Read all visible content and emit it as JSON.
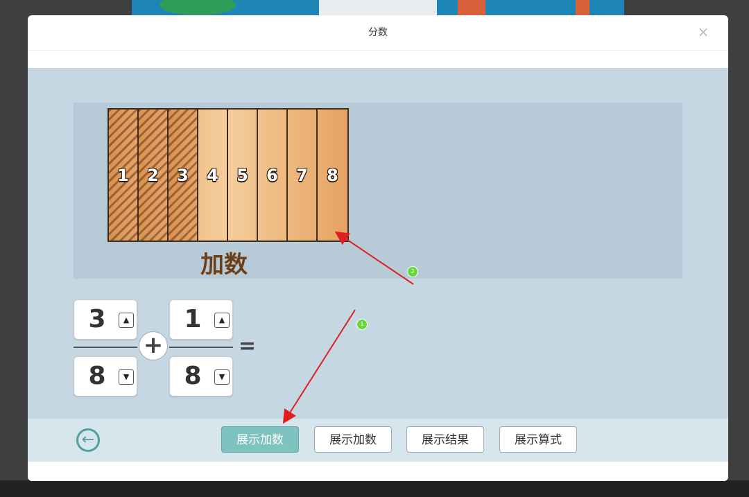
{
  "dialog": {
    "title": "分数",
    "close_label": "×"
  },
  "board": {
    "segments": [
      "1",
      "2",
      "3",
      "4",
      "5",
      "6",
      "7",
      "8"
    ],
    "hatched_count": 3,
    "label": "加数"
  },
  "fraction1": {
    "numerator": "3",
    "denominator": "8"
  },
  "fraction2": {
    "numerator": "1",
    "denominator": "8"
  },
  "operator": "+",
  "equals": "=",
  "steppers": {
    "up": "▲",
    "down": "▼"
  },
  "toolbar": {
    "back_icon": "←",
    "buttons": [
      "展示加数",
      "展示加数",
      "展示结果",
      "展示算式"
    ],
    "active_index": 0
  },
  "annotations": {
    "marker1": "1",
    "marker2": "2",
    "arrow_color": "#e01e1e"
  }
}
